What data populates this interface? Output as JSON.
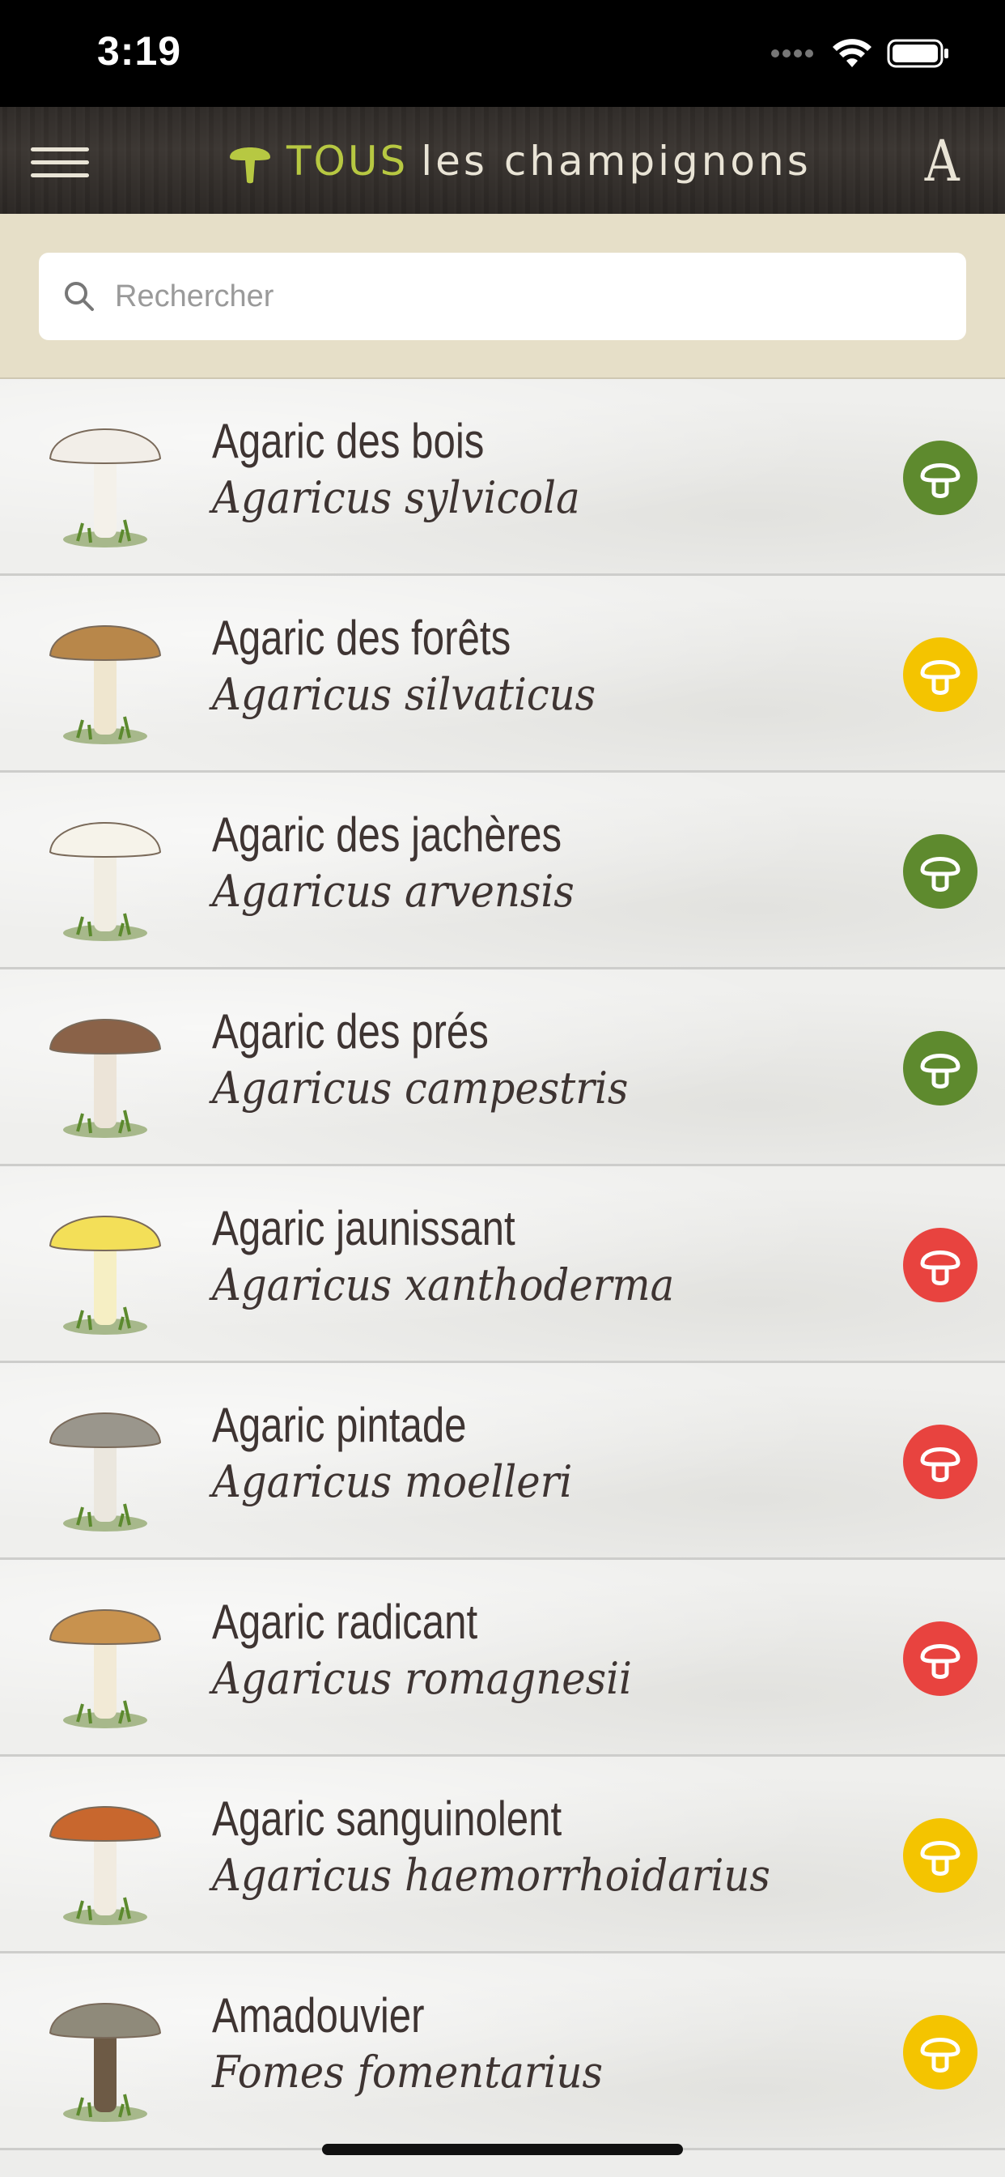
{
  "status_bar": {
    "time": "3:19"
  },
  "header": {
    "title_highlight": "TOUS",
    "title_rest": "les champignons",
    "font_button_label": "A"
  },
  "search": {
    "placeholder": "Rechercher",
    "value": ""
  },
  "colors": {
    "edible": "#5e8a2e",
    "caution": "#f4c400",
    "toxic": "#e8433f",
    "title_accent": "#b7c842"
  },
  "mushrooms": [
    {
      "common": "Agaric des bois",
      "latin": "Agaricus sylvicola",
      "status": "edible",
      "cap": "#f2eee8",
      "stem": "#f4f1ea"
    },
    {
      "common": "Agaric des forêts",
      "latin": "Agaricus silvaticus",
      "status": "caution",
      "cap": "#b8874a",
      "stem": "#efe6cf"
    },
    {
      "common": "Agaric des jachères",
      "latin": "Agaricus arvensis",
      "status": "edible",
      "cap": "#f6f3ea",
      "stem": "#f1ede2"
    },
    {
      "common": "Agaric des prés",
      "latin": "Agaricus campestris",
      "status": "edible",
      "cap": "#8a6248",
      "stem": "#ece4d8"
    },
    {
      "common": "Agaric jaunissant",
      "latin": "Agaricus xanthoderma",
      "status": "toxic",
      "cap": "#f3df58",
      "stem": "#f6efc4"
    },
    {
      "common": "Agaric pintade",
      "latin": "Agaricus moelleri",
      "status": "toxic",
      "cap": "#9a968c",
      "stem": "#ebe7de"
    },
    {
      "common": "Agaric radicant",
      "latin": "Agaricus romagnesii",
      "status": "toxic",
      "cap": "#c8924e",
      "stem": "#f2ead6"
    },
    {
      "common": "Agaric sanguinolent",
      "latin": "Agaricus haemorrhoidarius",
      "status": "caution",
      "cap": "#c8672e",
      "stem": "#f1ebe0"
    },
    {
      "common": "Amadouvier",
      "latin": "Fomes fomentarius",
      "status": "caution",
      "cap": "#8f8a7a",
      "stem": "#6d5a45"
    }
  ]
}
